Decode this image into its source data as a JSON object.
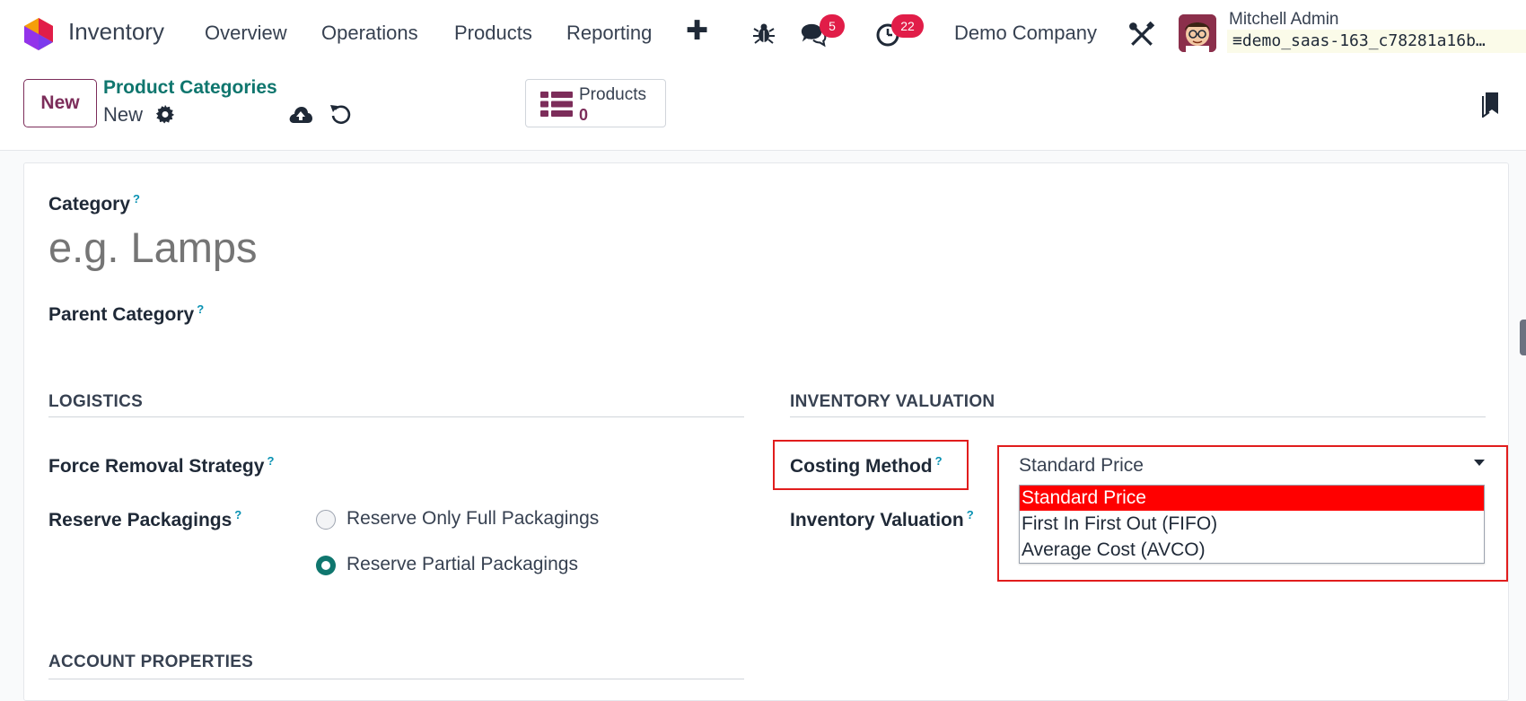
{
  "navbar": {
    "app_name": "Inventory",
    "menu": [
      "Overview",
      "Operations",
      "Products",
      "Reporting"
    ],
    "messages_count": "5",
    "activities_count": "22",
    "company": "Demo Company",
    "user_name": "Mitchell Admin",
    "database": "demo_saas-163_c78281a16b…"
  },
  "control": {
    "new_label": "New",
    "breadcrumb": "Product Categories",
    "record_name": "New",
    "smart_button": {
      "label": "Products",
      "value": "0"
    }
  },
  "form": {
    "category_label": "Category",
    "category_placeholder": "e.g. Lamps",
    "parent_category_label": "Parent Category",
    "help_mark": "?",
    "logistics": {
      "title": "LOGISTICS",
      "force_removal_label": "Force Removal Strategy",
      "reserve_packagings_label": "Reserve Packagings",
      "reserve_options": [
        {
          "label": "Reserve Only Full Packagings",
          "checked": false
        },
        {
          "label": "Reserve Partial Packagings",
          "checked": true
        }
      ]
    },
    "valuation": {
      "title": "INVENTORY VALUATION",
      "costing_method_label": "Costing Method",
      "costing_method_value": "Standard Price",
      "costing_options": [
        "Standard Price",
        "First In First Out (FIFO)",
        "Average Cost (AVCO)"
      ],
      "inventory_valuation_label": "Inventory Valuation"
    },
    "account_properties_title": "ACCOUNT PROPERTIES"
  },
  "colors": {
    "brand": "#7c2d5a",
    "link": "#0f766e",
    "badge": "#e11d48",
    "highlight": "#e11d1d",
    "selected_option": "#ff0000"
  }
}
